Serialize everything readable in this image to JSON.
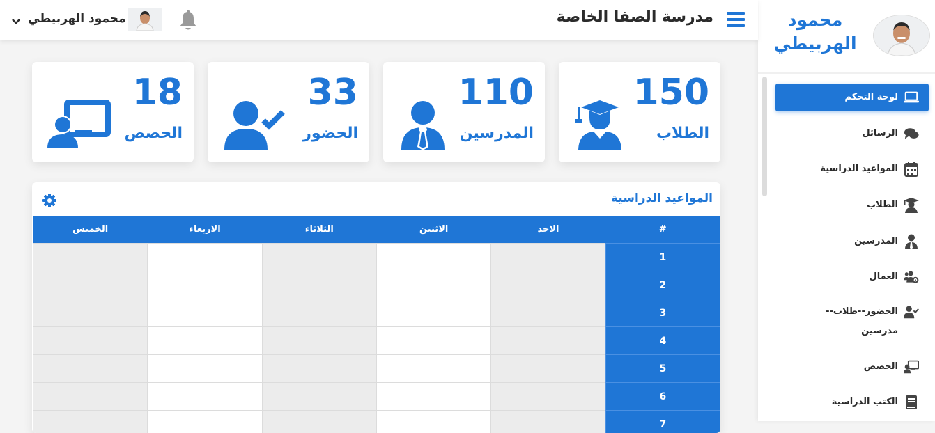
{
  "header": {
    "school_name": "مدرسة الصفا الخاصة",
    "user_name": "محمود الهربيطي",
    "menu_icon": "hamburger-icon",
    "bell_icon": "bell-icon",
    "caret_icon": "chevron-down-icon"
  },
  "sidebar": {
    "profile_name": "محمود الهربيطي",
    "items": [
      {
        "label": "لوحة التحكم",
        "icon": "laptop-icon",
        "active": true
      },
      {
        "label": "الرسائل",
        "icon": "comments-icon"
      },
      {
        "label": "المواعيد الدراسية",
        "icon": "calendar-icon"
      },
      {
        "label": "الطلاب",
        "icon": "graduate-icon"
      },
      {
        "label": "المدرسين",
        "icon": "user-tie-icon"
      },
      {
        "label": "العمال",
        "icon": "users-cog-icon"
      },
      {
        "label": "الحضور--طلاب--مدرسين",
        "icon": "user-check-icon"
      },
      {
        "label": "الحصص",
        "icon": "chalkboard-teacher-icon"
      },
      {
        "label": "الكتب الدراسية",
        "icon": "book-icon"
      }
    ]
  },
  "stats": [
    {
      "value": "150",
      "label": "الطلاب",
      "icon": "graduate-icon"
    },
    {
      "value": "110",
      "label": "المدرسين",
      "icon": "user-tie-icon"
    },
    {
      "value": "33",
      "label": "الحضور",
      "icon": "user-check-icon"
    },
    {
      "value": "18",
      "label": "الحصص",
      "icon": "chalkboard-teacher-icon"
    }
  ],
  "schedule": {
    "title": "المواعيد الدراسية",
    "settings_icon": "gear-icon",
    "columns": [
      "#",
      "الاحد",
      "الاثنين",
      "الثلاثاء",
      "الاربعاء",
      "الخميس"
    ],
    "rows": [
      "1",
      "2",
      "3",
      "4",
      "5",
      "6",
      "7"
    ]
  },
  "colors": {
    "accent": "#1f76d6",
    "cell_gray": "#ececec",
    "icon_gray": "#9a9a9a"
  }
}
